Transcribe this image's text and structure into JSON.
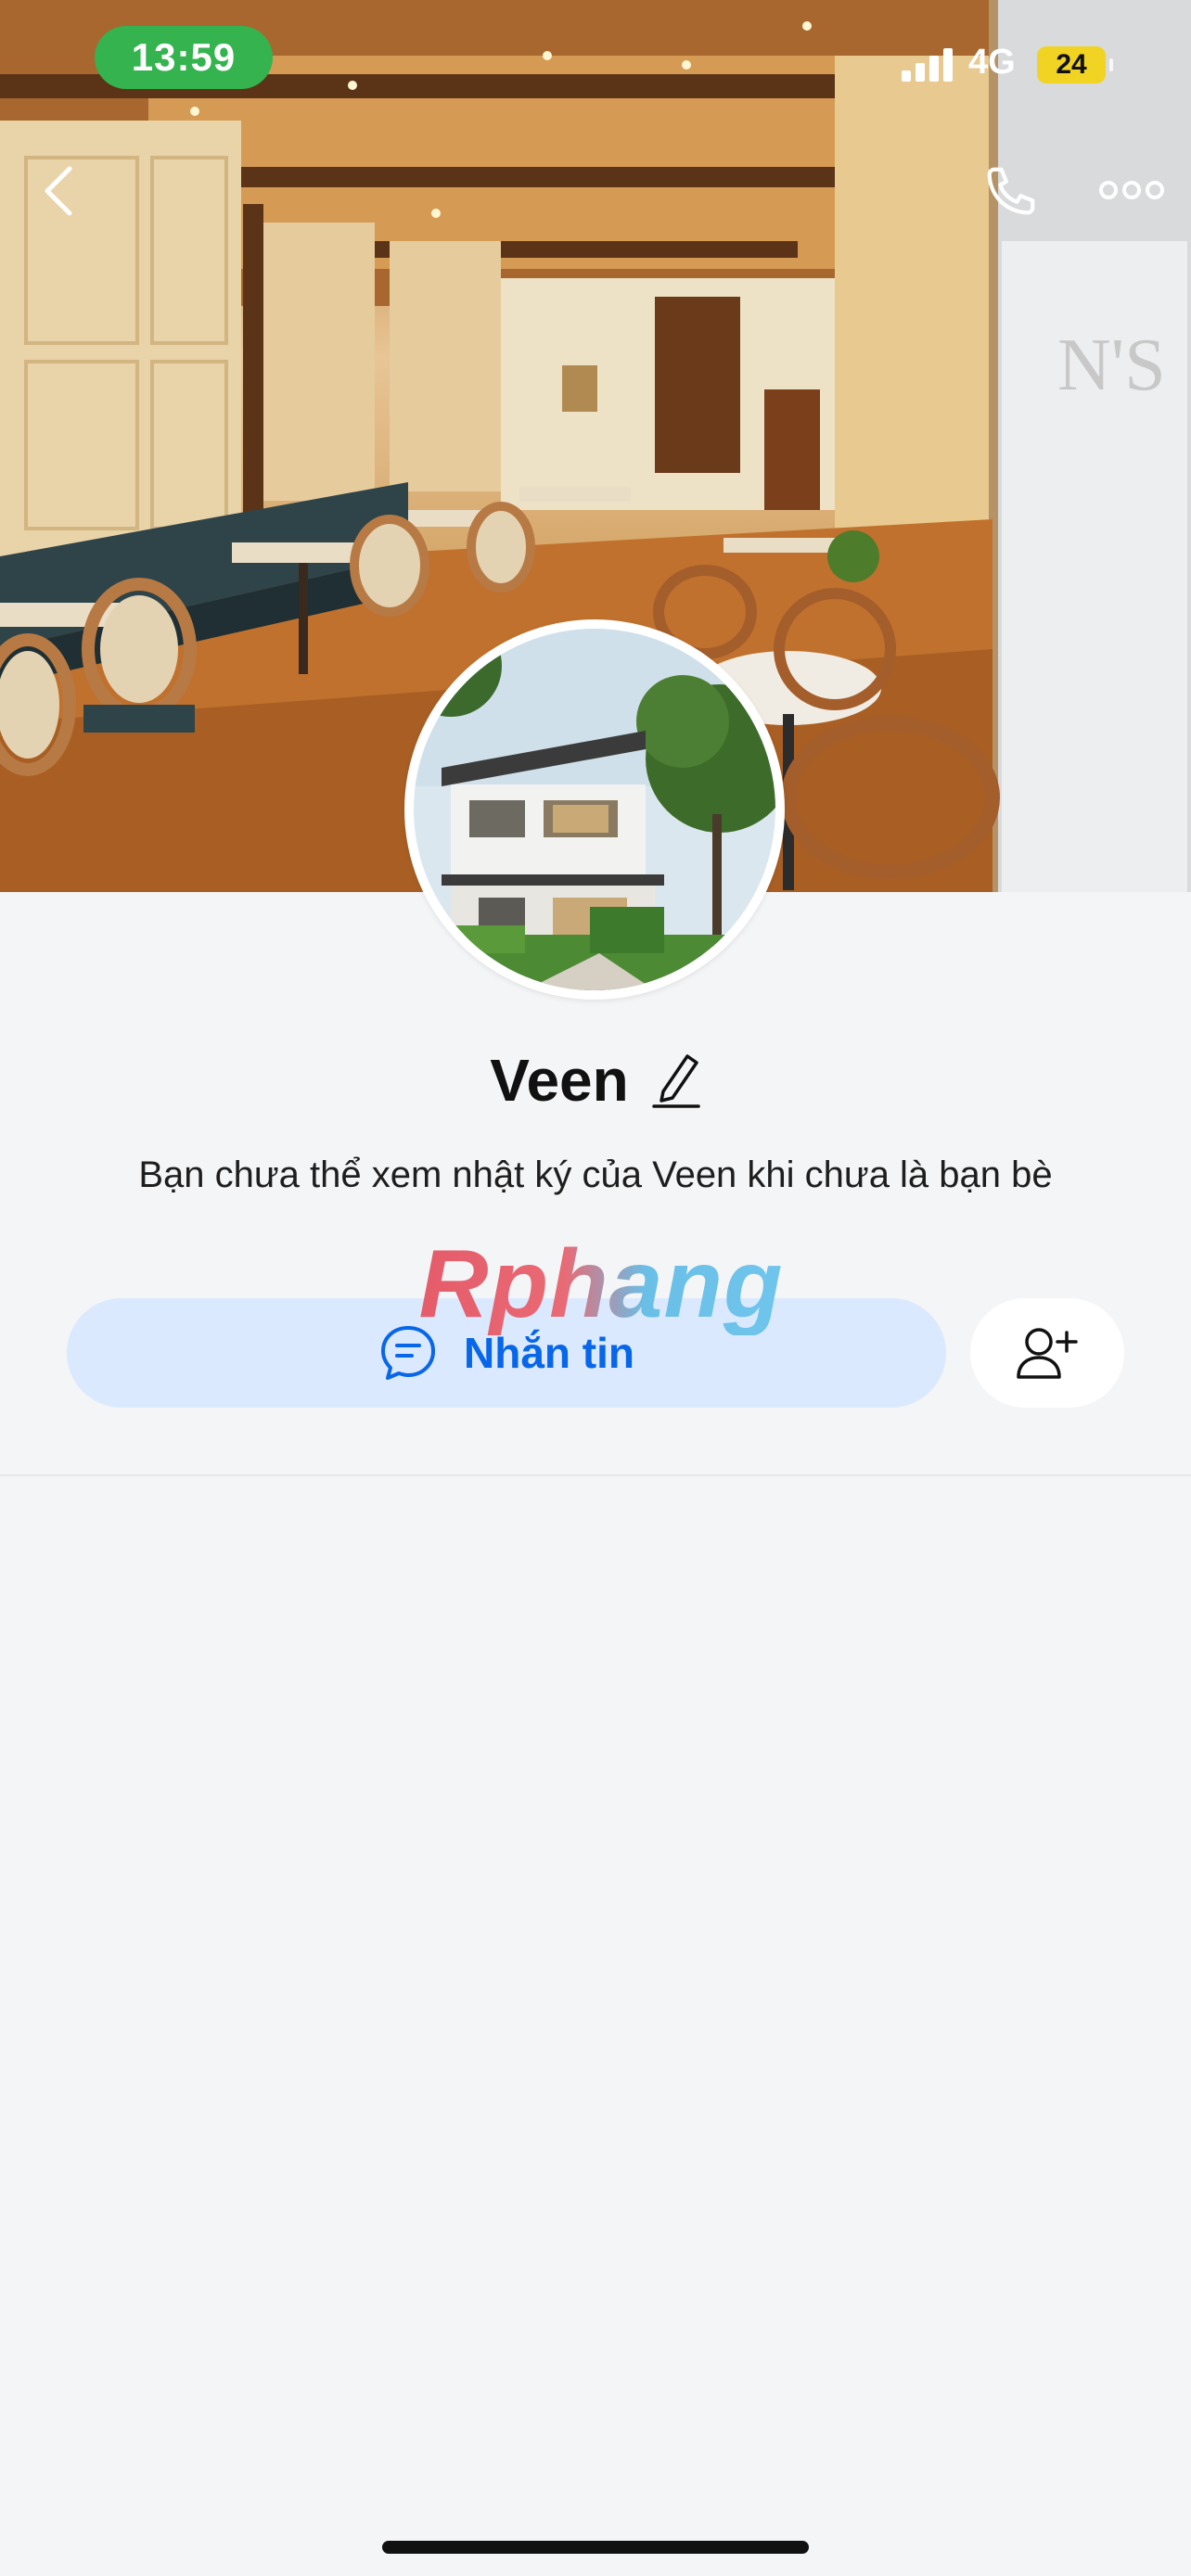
{
  "status_bar": {
    "time": "13:59",
    "network": "4G",
    "battery": "24"
  },
  "header": {
    "back_icon": "chevron-left-icon",
    "call_icon": "phone-icon",
    "more_icon": "more-horizontal-icon"
  },
  "profile": {
    "name": "Veen",
    "notice": "Bạn chưa thể xem nhật ký của Veen khi chưa là bạn bè",
    "edit_icon": "pencil-icon"
  },
  "actions": {
    "message_label": "Nhắn tin",
    "message_icon": "chat-bubble-icon",
    "add_friend_icon": "add-user-icon"
  },
  "watermark": "Rphang",
  "colors": {
    "accent": "#0866e8",
    "message_button_bg": "#dbe9fe",
    "time_pill": "#34b34f",
    "page_bg": "#f4f5f7"
  }
}
